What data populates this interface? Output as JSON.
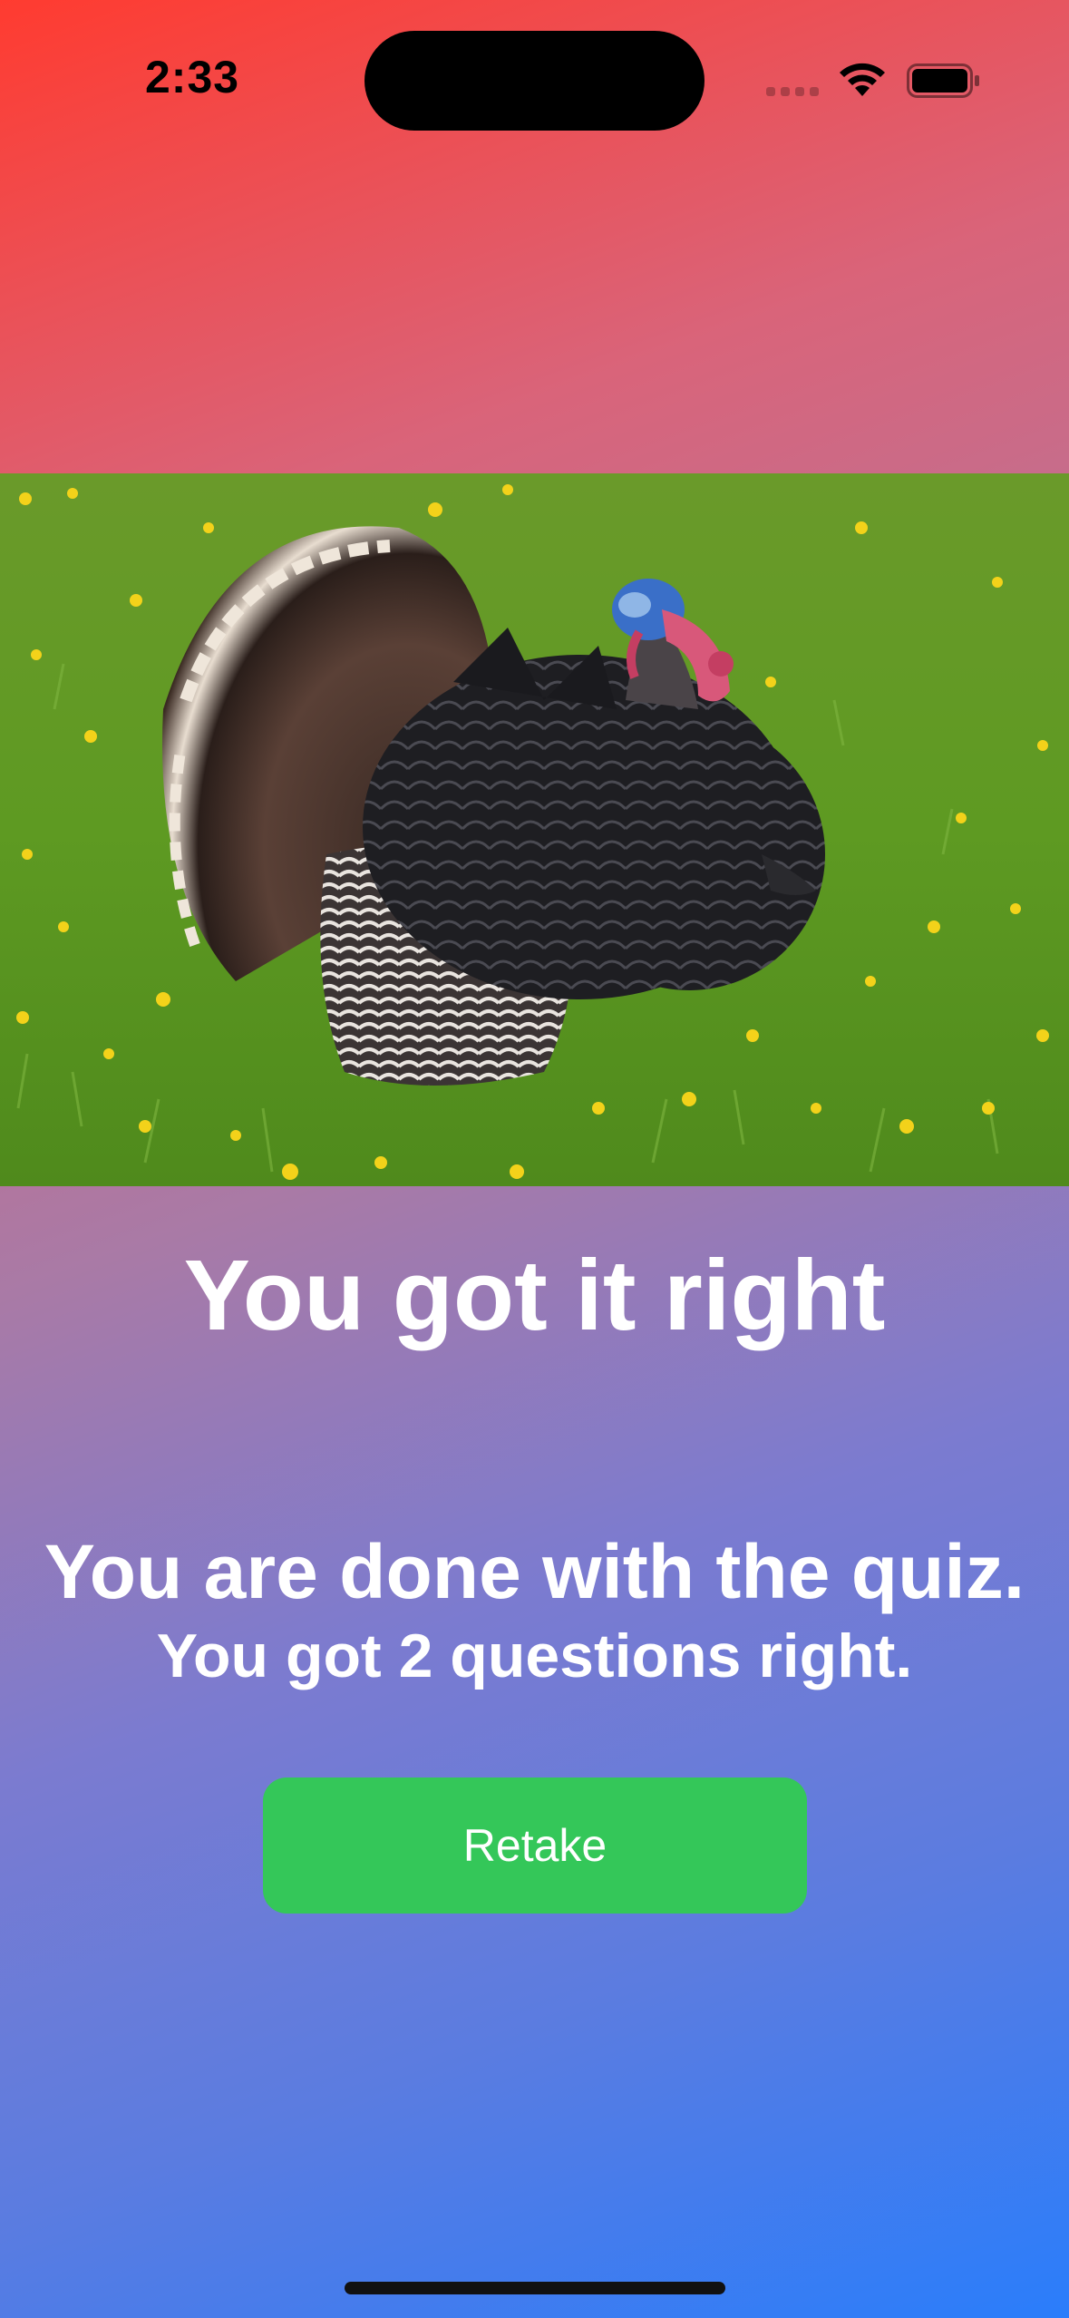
{
  "status_bar": {
    "time": "2:33",
    "icons": [
      "cellular-signal-icon",
      "wifi-icon",
      "battery-icon"
    ]
  },
  "photo": {
    "subject": "wild turkey in grass field with yellow dandelions"
  },
  "result": {
    "title": "You got it right",
    "done_message": "You are done with the quiz.",
    "score_message": "You got 2 questions right."
  },
  "actions": {
    "retake_label": "Retake"
  },
  "colors": {
    "gradient_start": "#ff3b30",
    "gradient_end": "#2a7dfb",
    "button": "#34c759",
    "text": "#ffffff"
  }
}
